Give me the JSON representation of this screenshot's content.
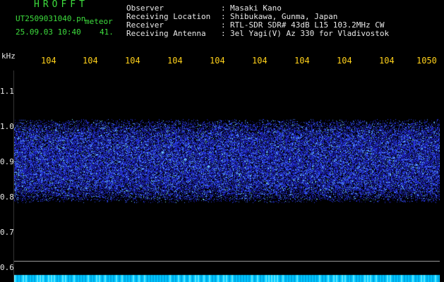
{
  "header": {
    "brand": "HROFFT",
    "filename": "UT2509031040.pn",
    "datetime": "25.09.03 10:40",
    "meteor_label": "meteor",
    "meteor_count": "41.",
    "observer_label": "Observer",
    "observer_value": "Masaki Kano",
    "location_label": "Receiving Location",
    "location_value": "Shibukawa, Gunma, Japan",
    "receiver_label": "Receiver",
    "receiver_value": "RTL-SDR SDR# 43dB L15 103.2MHz CW",
    "antenna_label": "Receiving Antenna",
    "antenna_value": "3el Yagi(V) Az 330 for Vladivostok"
  },
  "axis": {
    "unit": "kHz",
    "y_ticks": [
      "1.1",
      "1.0",
      "0.9",
      "0.8",
      "0.7",
      "0.6"
    ],
    "x_ticks": [
      "104",
      "104",
      "104",
      "104",
      "104",
      "104",
      "104",
      "104",
      "104",
      "1050"
    ]
  },
  "colors": {
    "noise_low": "#1a1aa0",
    "noise_mid": "#2f3cff",
    "noise_high": "#7ff8ff",
    "bottom_band": "#00c8ff",
    "label_green": "#3ddc3d",
    "label_yellow": "#ffd11a"
  }
}
